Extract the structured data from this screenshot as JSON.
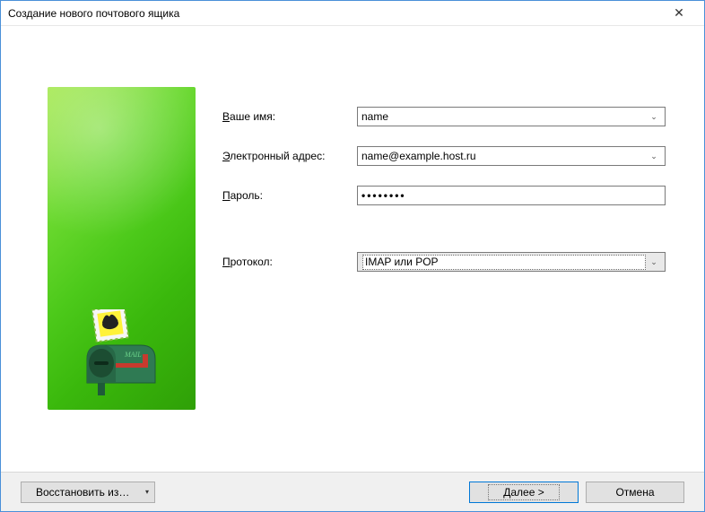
{
  "window": {
    "title": "Создание нового почтового ящика"
  },
  "form": {
    "name": {
      "label_pre": "В",
      "label_rest": "аше имя:",
      "value": "name"
    },
    "email": {
      "label_pre": "Э",
      "label_rest": "лектронный адрес:",
      "value": "name@example.host.ru"
    },
    "password": {
      "label_pre": "П",
      "label_rest": "ароль:",
      "value_masked": "••••••••"
    },
    "protocol": {
      "label_pre": "П",
      "label_rest": "ротокол:",
      "value": "IMAP или POP"
    }
  },
  "buttons": {
    "restore": "Восстановить из…",
    "next": "Далее  >",
    "cancel": "Отмена"
  },
  "icons": {
    "close": "✕",
    "dropdown": "▾",
    "combo": "⌄"
  }
}
